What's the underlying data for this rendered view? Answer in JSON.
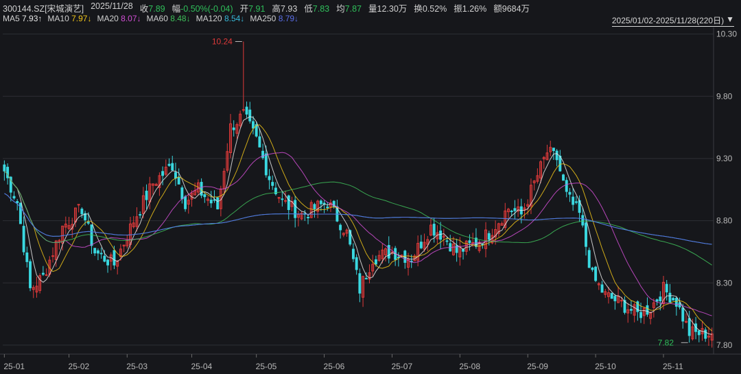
{
  "quote": {
    "code": "300144.SZ[宋城演艺]",
    "date": "2025/11/28",
    "close_label": "收",
    "close": "7.89",
    "change_label": "幅",
    "change": "-0.50%(-0.04)",
    "open_label": "开",
    "open": "7.91",
    "high_label": "高",
    "high": "7.93",
    "low_label": "低",
    "low": "7.83",
    "avg_label": "均",
    "avg": "7.87",
    "vol_label": "量",
    "vol": "12.30万",
    "turn_label": "换",
    "turn": "0.52%",
    "amp_label": "振",
    "amp": "1.26%",
    "amount_label": "额",
    "amount": "9684万"
  },
  "ma_legend": [
    {
      "label": "MA5",
      "value": "7.93↑",
      "color": "#e8e8e8"
    },
    {
      "label": "MA10",
      "value": "7.97↓",
      "color": "#f0c419"
    },
    {
      "label": "MA20",
      "value": "8.07↓",
      "color": "#d34fd6"
    },
    {
      "label": "MA60",
      "value": "8.48↓",
      "color": "#3fbf5a"
    },
    {
      "label": "MA120",
      "value": "8.54↓",
      "color": "#37b8d8"
    },
    {
      "label": "MA250",
      "value": "8.79↓",
      "color": "#5b6ee8"
    }
  ],
  "range": {
    "text": "2025/01/02-2025/11/28(220日)",
    "icon": "triangle-down-icon"
  },
  "colors": {
    "up": "#e03a3a",
    "down": "#3ad8e0",
    "bg": "#16171b",
    "grid": "#2e2f35"
  },
  "chart_data": {
    "type": "candlestick",
    "ylim": [
      7.75,
      10.32
    ],
    "y_ticks": [
      "10.30",
      "9.80",
      "9.30",
      "8.80",
      "8.30",
      "7.80"
    ],
    "x_ticks": [
      "25-01",
      "25-02",
      "25-03",
      "25-04",
      "25-05",
      "25-06",
      "25-07",
      "25-08",
      "25-09",
      "25-10",
      "25-11"
    ],
    "x_tick_index": [
      0,
      20,
      38,
      58,
      78,
      99,
      120,
      141,
      162,
      183,
      204
    ],
    "annotations": [
      {
        "text": "10.24",
        "index": 74,
        "value": 10.24,
        "color": "#e03a3a"
      },
      {
        "text": "7.82",
        "index": 212,
        "value": 7.82,
        "color": "#2fbf5a"
      }
    ],
    "keypoints": [
      [
        0,
        9.2
      ],
      [
        4,
        8.95
      ],
      [
        8,
        8.25
      ],
      [
        12,
        8.35
      ],
      [
        18,
        8.75
      ],
      [
        24,
        8.9
      ],
      [
        28,
        8.55
      ],
      [
        34,
        8.45
      ],
      [
        40,
        8.8
      ],
      [
        46,
        9.1
      ],
      [
        52,
        9.25
      ],
      [
        56,
        8.95
      ],
      [
        60,
        9.05
      ],
      [
        66,
        8.9
      ],
      [
        70,
        9.55
      ],
      [
        74,
        9.65
      ],
      [
        78,
        9.45
      ],
      [
        82,
        9.15
      ],
      [
        86,
        8.95
      ],
      [
        92,
        8.85
      ],
      [
        100,
        8.95
      ],
      [
        106,
        8.7
      ],
      [
        110,
        8.25
      ],
      [
        114,
        8.5
      ],
      [
        120,
        8.55
      ],
      [
        126,
        8.5
      ],
      [
        132,
        8.75
      ],
      [
        136,
        8.68
      ],
      [
        140,
        8.55
      ],
      [
        146,
        8.62
      ],
      [
        150,
        8.7
      ],
      [
        156,
        8.9
      ],
      [
        160,
        8.85
      ],
      [
        164,
        9.1
      ],
      [
        168,
        9.35
      ],
      [
        171,
        9.3
      ],
      [
        174,
        9.0
      ],
      [
        178,
        8.85
      ],
      [
        182,
        8.35
      ],
      [
        186,
        8.2
      ],
      [
        190,
        8.15
      ],
      [
        196,
        8.05
      ],
      [
        200,
        8.1
      ],
      [
        204,
        8.25
      ],
      [
        208,
        8.15
      ],
      [
        212,
        7.9
      ],
      [
        219,
        7.89
      ]
    ],
    "last_close": 7.89,
    "count": 220,
    "series": [
      {
        "name": "MA5",
        "period": 5
      },
      {
        "name": "MA10",
        "period": 10
      },
      {
        "name": "MA20",
        "period": 20
      },
      {
        "name": "MA60",
        "period": 60
      },
      {
        "name": "MA120",
        "period": 120
      },
      {
        "name": "MA250",
        "period": 250
      }
    ]
  }
}
